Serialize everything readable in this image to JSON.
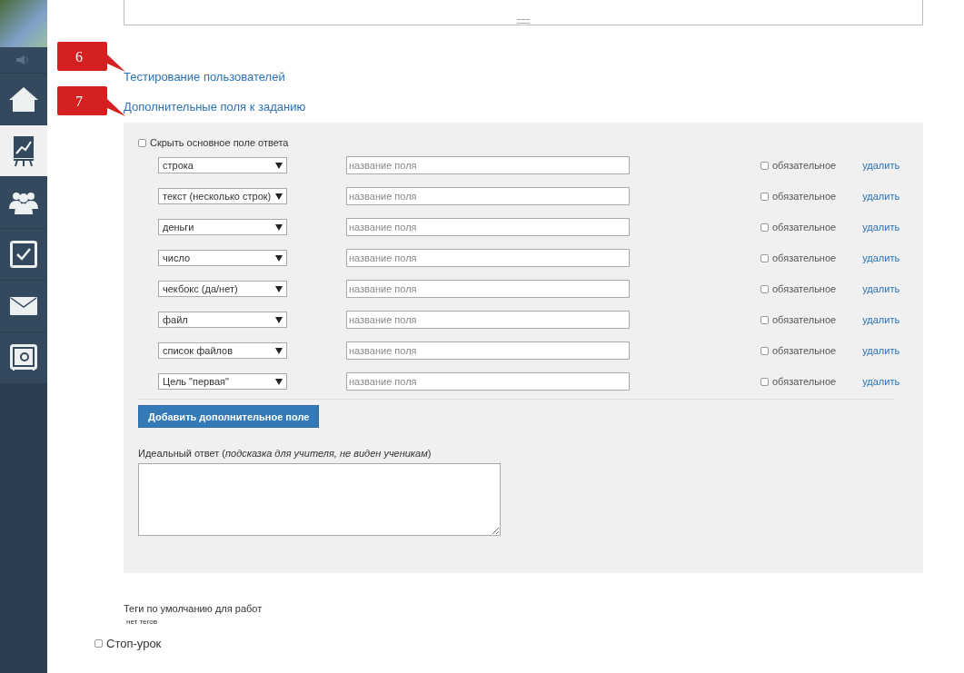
{
  "sidebar": {
    "items": [
      {
        "kind": "home",
        "selected": false
      },
      {
        "kind": "chart",
        "selected": true
      },
      {
        "kind": "people",
        "selected": false
      },
      {
        "kind": "tasks",
        "selected": false
      },
      {
        "kind": "mail",
        "selected": false
      },
      {
        "kind": "safe",
        "selected": false
      }
    ]
  },
  "annotations": [
    {
      "number": "6"
    },
    {
      "number": "7"
    }
  ],
  "links": [
    "Тестирование пользователей",
    "Дополнительные поля к заданию"
  ],
  "hide_main_field": {
    "label": "Скрыть основное поле ответа",
    "checked": false
  },
  "fields": [
    {
      "type": "строка",
      "placeholder": "название поля",
      "required_label": "обязательное",
      "required": false,
      "delete": "удалить"
    },
    {
      "type": "текст (несколько строк)",
      "placeholder": "название поля",
      "required_label": "обязательное",
      "required": false,
      "delete": "удалить"
    },
    {
      "type": "деньги",
      "placeholder": "название поля",
      "required_label": "обязательное",
      "required": false,
      "delete": "удалить"
    },
    {
      "type": "число",
      "placeholder": "название поля",
      "required_label": "обязательное",
      "required": false,
      "delete": "удалить"
    },
    {
      "type": "чекбокс (да/нет)",
      "placeholder": "название поля",
      "required_label": "обязательное",
      "required": false,
      "delete": "удалить"
    },
    {
      "type": "файл",
      "placeholder": "название поля",
      "required_label": "обязательное",
      "required": false,
      "delete": "удалить"
    },
    {
      "type": "список файлов",
      "placeholder": "название поля",
      "required_label": "обязательное",
      "required": false,
      "delete": "удалить"
    },
    {
      "type": "Цель \"первая\"",
      "placeholder": "название поля",
      "required_label": "обязательное",
      "required": false,
      "delete": "удалить"
    }
  ],
  "add_button": "Добавить дополнительное поле",
  "ideal_answer": {
    "label": "Идеальный ответ (*подсказка для учителя, не виден ученикам*)"
  },
  "tags": {
    "label": "Теги по умолчанию для работ",
    "value": "нет тегов"
  },
  "stop_lesson": {
    "label": "Стоп-урок",
    "checked": false
  }
}
